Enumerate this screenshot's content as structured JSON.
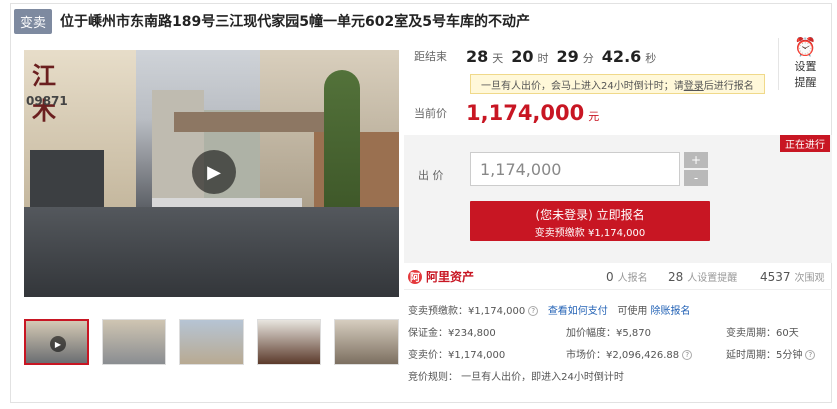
{
  "header": {
    "tag": "变卖",
    "title": "位于嵊州市东南路189号三江现代家园5幢一单元602室及5号车库的不动产"
  },
  "photo": {
    "sign_text": "江 木",
    "number_text": "09871"
  },
  "countdown": {
    "label": "距结束",
    "days": "28",
    "days_unit": "天",
    "hours": "20",
    "hours_unit": "时",
    "minutes": "29",
    "minutes_unit": "分",
    "seconds": "42.6",
    "seconds_unit": "秒"
  },
  "reminder": {
    "label_line1": "设置",
    "label_line2": "提醒",
    "icon": "alarm-clock-icon"
  },
  "notice": {
    "text_before": "一旦有人出价，会马上进入24小时倒计时；请",
    "link": "登录",
    "text_after": "后进行报名"
  },
  "current_price": {
    "label": "当前价",
    "value": "1,174,000",
    "unit": "元"
  },
  "bid": {
    "status": "正在进行",
    "label": "出  价",
    "input_value": "1,174,000",
    "plus": "+",
    "minus": "-",
    "signup_main": "(您未登录) 立即报名",
    "signup_sub": "变卖预缴款 ¥1,174,000"
  },
  "stats": {
    "brand": "阿里资产",
    "registered_count": "0",
    "registered_label": "人报名",
    "reminder_count": "28",
    "reminder_label": "人设置提醒",
    "views_count": "4537",
    "views_label": "次围观"
  },
  "details": {
    "deposit_label": "变卖预缴款：¥1,174,000",
    "how_to_pay": "查看如何支付",
    "usable": "可使用",
    "loan_link": "除账报名",
    "security_deposit": "保证金：¥234,800",
    "increment": "加价幅度：¥5,870",
    "period": "变卖周期：60天",
    "sale_price": "变卖价：¥1,174,000",
    "market_price": "市场价：¥2,096,426.88",
    "delay": "延时周期：5分钟",
    "rule": "竞价规则：  一旦有人出价，即进入24小时倒计时"
  },
  "colors": {
    "accent": "#c81623",
    "tag_bg": "#7e8aa0",
    "link": "#2463b6"
  }
}
